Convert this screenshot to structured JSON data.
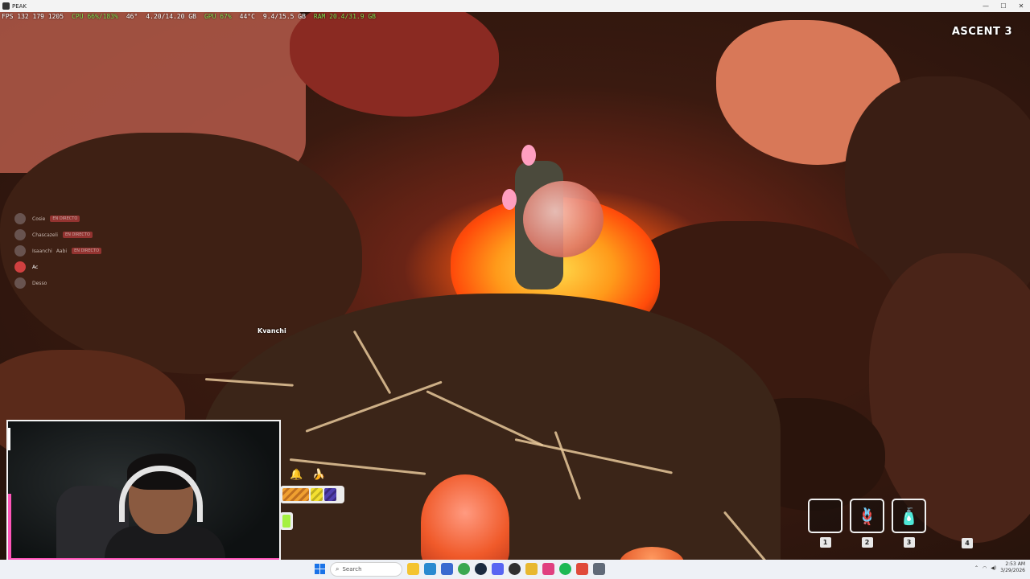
{
  "window": {
    "title": "PEAK"
  },
  "osd": {
    "fps": "FPS 132 179 1205",
    "cpu": "CPU 66%/183%",
    "bar": "46°",
    "mem": "4.20/14.20 GB",
    "gpu": "GPU 67%",
    "gpu_temp": "44°C",
    "vram": "9.4/15.5 GB",
    "ram": "RAM 20.4/31.9 GB"
  },
  "hud": {
    "level": "ASCENT 3"
  },
  "players": [
    {
      "name": "Cosie",
      "badge": "EN DIRECTO"
    },
    {
      "name": "Chascazeli",
      "badge": "EN DIRECTO"
    },
    {
      "name": "Isaanchi",
      "badge": "EN DIRECTO",
      "extra": "Aabi"
    },
    {
      "name": "Ac",
      "badge": ""
    },
    {
      "name": "Desso",
      "badge": ""
    }
  ],
  "nametag": "Kvanchi",
  "status": {
    "stamina": {
      "orange": 0.45,
      "yellow": 0.2,
      "purple": 0.2
    },
    "extra_fill": 1.0
  },
  "inventory": {
    "slots": [
      {
        "num": "1",
        "icon": "empty-slot"
      },
      {
        "num": "2",
        "icon": "rope-icon",
        "glyph": "🪢"
      },
      {
        "num": "3",
        "icon": "water-bottle-icon",
        "glyph": "🧴"
      }
    ],
    "slot4_num": "4"
  },
  "taskbar": {
    "search_placeholder": "Search",
    "time": "2:53 AM",
    "date": "3/29/2026"
  },
  "colors": {
    "accent_pink": "#ff55b8",
    "stamina_orange": "#f0a030",
    "stamina_green": "#a4f040"
  }
}
